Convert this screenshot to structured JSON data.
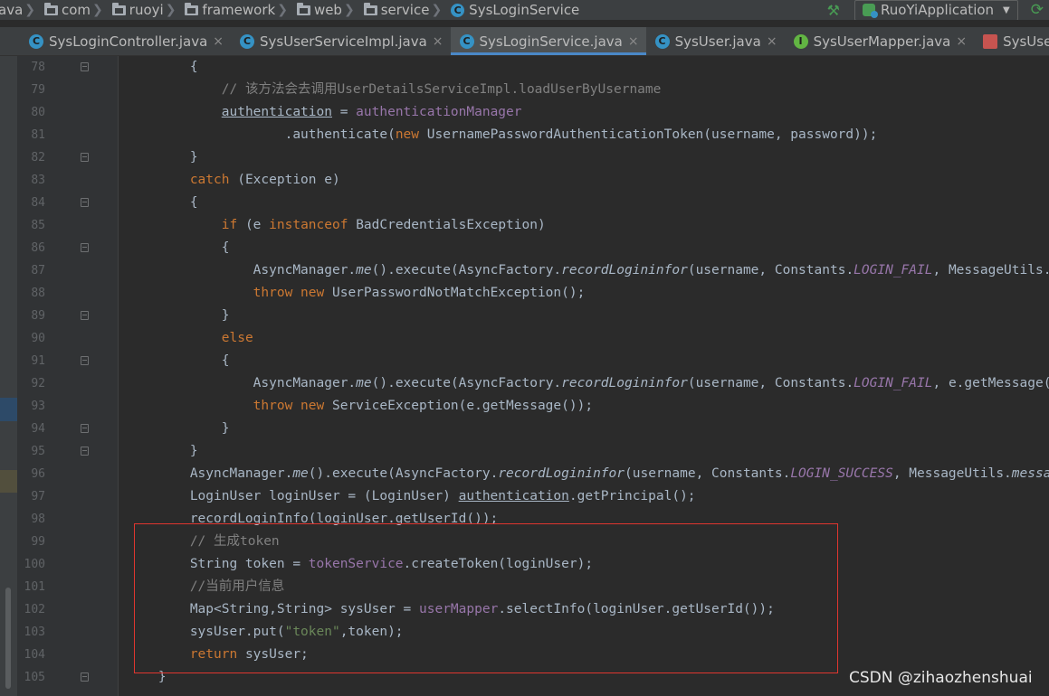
{
  "breadcrumb": {
    "items": [
      {
        "label": "ava",
        "icon": "none"
      },
      {
        "label": "com",
        "icon": "folder-icon"
      },
      {
        "label": "ruoyi",
        "icon": "folder-icon"
      },
      {
        "label": "framework",
        "icon": "folder-icon"
      },
      {
        "label": "web",
        "icon": "folder-icon"
      },
      {
        "label": "service",
        "icon": "folder-icon"
      },
      {
        "label": "SysLoginService",
        "icon": "class-icon"
      }
    ]
  },
  "toolbar": {
    "run_config": "RuoYiApplication"
  },
  "tabs": [
    {
      "label": "SysLoginController.java",
      "icon": "C",
      "active": false
    },
    {
      "label": "SysUserServiceImpl.java",
      "icon": "C",
      "active": false
    },
    {
      "label": "SysLoginService.java",
      "icon": "C",
      "active": true
    },
    {
      "label": "SysUser.java",
      "icon": "C",
      "active": false
    },
    {
      "label": "SysUserMapper.java",
      "icon": "I",
      "active": false
    },
    {
      "label": "SysUserM",
      "icon": "X",
      "active": false
    }
  ],
  "colors": {
    "keyword": "#cc7832",
    "comment": "#808080",
    "field": "#9876aa",
    "string": "#6a8759",
    "text": "#a9b7c6",
    "highlight_box": "#e0362f"
  },
  "code_lines": [
    {
      "num": "78",
      "fold": true,
      "indent": 8,
      "tokens": [
        [
          "p",
          "{"
        ]
      ]
    },
    {
      "num": "79",
      "fold": false,
      "indent": 12,
      "tokens": [
        [
          "cm",
          "// 该方法会去调用UserDetailsServiceImpl.loadUserByUsername"
        ]
      ]
    },
    {
      "num": "80",
      "fold": false,
      "indent": 12,
      "tokens": [
        [
          "uf",
          "authentication"
        ],
        [
          "p",
          " = "
        ],
        [
          "f",
          "authenticationManager"
        ]
      ]
    },
    {
      "num": "81",
      "fold": false,
      "indent": 20,
      "tokens": [
        [
          "p",
          ".authenticate("
        ],
        [
          "k",
          "new "
        ],
        [
          "p",
          "UsernamePasswordAuthenticationToken(username, password));"
        ]
      ]
    },
    {
      "num": "82",
      "fold": true,
      "indent": 8,
      "tokens": [
        [
          "p",
          "}"
        ]
      ]
    },
    {
      "num": "83",
      "fold": false,
      "indent": 8,
      "tokens": [
        [
          "k",
          "catch "
        ],
        [
          "p",
          "(Exception e)"
        ]
      ]
    },
    {
      "num": "84",
      "fold": true,
      "indent": 8,
      "tokens": [
        [
          "p",
          "{"
        ]
      ]
    },
    {
      "num": "85",
      "fold": false,
      "indent": 12,
      "tokens": [
        [
          "k",
          "if "
        ],
        [
          "p",
          "(e "
        ],
        [
          "k",
          "instanceof "
        ],
        [
          "p",
          "BadCredentialsException)"
        ]
      ]
    },
    {
      "num": "86",
      "fold": true,
      "indent": 12,
      "tokens": [
        [
          "p",
          "{"
        ]
      ]
    },
    {
      "num": "87",
      "fold": false,
      "indent": 16,
      "tokens": [
        [
          "p",
          "AsyncManager."
        ],
        [
          "i",
          "me"
        ],
        [
          "p",
          "().execute(AsyncFactory."
        ],
        [
          "i",
          "recordLogininfor"
        ],
        [
          "p",
          "(username, Constants."
        ],
        [
          "c",
          "LOGIN_FAIL"
        ],
        [
          "p",
          ", MessageUtils."
        ],
        [
          "i",
          "m"
        ]
      ]
    },
    {
      "num": "88",
      "fold": false,
      "indent": 16,
      "tokens": [
        [
          "k",
          "throw new "
        ],
        [
          "p",
          "UserPasswordNotMatchException();"
        ]
      ]
    },
    {
      "num": "89",
      "fold": true,
      "indent": 12,
      "tokens": [
        [
          "p",
          "}"
        ]
      ]
    },
    {
      "num": "90",
      "fold": false,
      "indent": 12,
      "tokens": [
        [
          "k",
          "else"
        ]
      ]
    },
    {
      "num": "91",
      "fold": true,
      "indent": 12,
      "tokens": [
        [
          "p",
          "{"
        ]
      ]
    },
    {
      "num": "92",
      "fold": false,
      "indent": 16,
      "tokens": [
        [
          "p",
          "AsyncManager."
        ],
        [
          "i",
          "me"
        ],
        [
          "p",
          "().execute(AsyncFactory."
        ],
        [
          "i",
          "recordLogininfor"
        ],
        [
          "p",
          "(username, Constants."
        ],
        [
          "c",
          "LOGIN_FAIL"
        ],
        [
          "p",
          ", e.getMessage()"
        ]
      ]
    },
    {
      "num": "93",
      "fold": false,
      "indent": 16,
      "tokens": [
        [
          "k",
          "throw new "
        ],
        [
          "p",
          "ServiceException(e.getMessage());"
        ]
      ]
    },
    {
      "num": "94",
      "fold": true,
      "indent": 12,
      "tokens": [
        [
          "p",
          "}"
        ]
      ]
    },
    {
      "num": "95",
      "fold": true,
      "indent": 8,
      "tokens": [
        [
          "p",
          "}"
        ]
      ]
    },
    {
      "num": "96",
      "fold": false,
      "indent": 8,
      "tokens": [
        [
          "p",
          "AsyncManager."
        ],
        [
          "i",
          "me"
        ],
        [
          "p",
          "().execute(AsyncFactory."
        ],
        [
          "i",
          "recordLogininfor"
        ],
        [
          "p",
          "(username, Constants."
        ],
        [
          "c",
          "LOGIN_SUCCESS"
        ],
        [
          "p",
          ", MessageUtils."
        ],
        [
          "i",
          "messag"
        ]
      ]
    },
    {
      "num": "97",
      "fold": false,
      "indent": 8,
      "tokens": [
        [
          "p",
          "LoginUser loginUser = (LoginUser) "
        ],
        [
          "uf",
          "authentication"
        ],
        [
          "p",
          ".getPrincipal();"
        ]
      ]
    },
    {
      "num": "98",
      "fold": false,
      "indent": 8,
      "tokens": [
        [
          "p",
          "recordLoginInfo(loginUser.getUserId());"
        ]
      ]
    },
    {
      "num": "99",
      "fold": false,
      "indent": 8,
      "tokens": [
        [
          "cm",
          "// 生成token"
        ]
      ]
    },
    {
      "num": "100",
      "fold": false,
      "indent": 8,
      "tokens": [
        [
          "p",
          "String token = "
        ],
        [
          "f",
          "tokenService"
        ],
        [
          "p",
          ".createToken(loginUser);"
        ]
      ]
    },
    {
      "num": "101",
      "fold": false,
      "indent": 8,
      "tokens": [
        [
          "cm",
          "//当前用户信息"
        ]
      ]
    },
    {
      "num": "102",
      "fold": false,
      "indent": 8,
      "tokens": [
        [
          "p",
          "Map<String,String> sysUser = "
        ],
        [
          "f",
          "userMapper"
        ],
        [
          "p",
          ".selectInfo(loginUser.getUserId());"
        ]
      ]
    },
    {
      "num": "103",
      "fold": false,
      "indent": 8,
      "tokens": [
        [
          "p",
          "sysUser.put("
        ],
        [
          "s",
          "\"token\""
        ],
        [
          "p",
          ",token);"
        ]
      ]
    },
    {
      "num": "104",
      "fold": false,
      "indent": 8,
      "tokens": [
        [
          "k",
          "return "
        ],
        [
          "p",
          "sysUser;"
        ]
      ]
    },
    {
      "num": "105",
      "fold": true,
      "indent": 4,
      "tokens": [
        [
          "p",
          "}"
        ]
      ]
    }
  ],
  "watermark": "CSDN @zihaozhenshuai"
}
